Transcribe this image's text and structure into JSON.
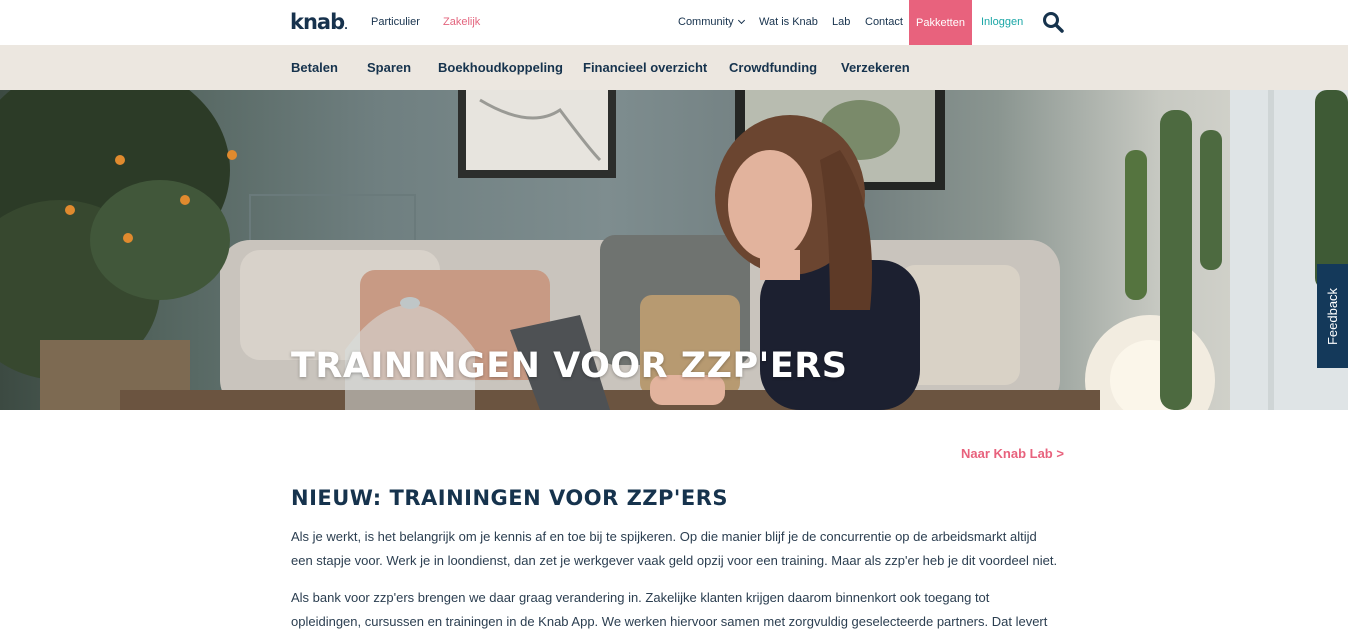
{
  "header": {
    "logo": "knab",
    "segments": [
      "Particulier",
      "Zakelijk"
    ],
    "links": {
      "community": "Community",
      "wat_is_knab": "Wat is Knab",
      "lab": "Lab",
      "contact": "Contact",
      "pakketten": "Pakketten",
      "inloggen": "Inloggen"
    },
    "search_icon": "search-icon"
  },
  "subnav": {
    "items": [
      "Betalen",
      "Sparen",
      "Boekhoudkoppeling",
      "Financieel overzicht",
      "Crowdfunding",
      "Verzekeren"
    ]
  },
  "hero": {
    "title": "TRAININGEN VOOR ZZP'ERS"
  },
  "feedback": {
    "label": "Feedback"
  },
  "content": {
    "lab_link": "Naar Knab Lab >",
    "heading": "NIEUW: TRAININGEN VOOR ZZP'ERS",
    "paragraph_1": "Als je werkt, is het belangrijk om je kennis af en toe bij te spijkeren. Op die manier blijf je de concurrentie op de arbeidsmarkt altijd een stapje voor. Werk je in loondienst, dan zet je werkgever vaak geld opzij voor een training. Maar als zzp'er heb je dit voordeel niet.",
    "paragraph_2": "Als bank voor zzp'ers brengen we daar graag verandering in. Zakelijke klanten krijgen daarom binnenkort ook toegang tot opleidingen, cursussen en trainingen in de Knab App. We werken hiervoor samen met zorgvuldig geselecteerde partners. Dat levert"
  },
  "colors": {
    "navy": "#16334d",
    "pink": "#e8627d",
    "teal": "#1aa6a6",
    "subnav_bg": "#ece7e0",
    "feedback_bg": "#14395a"
  }
}
